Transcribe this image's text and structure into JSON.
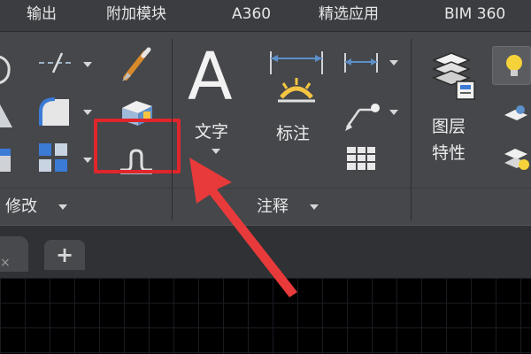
{
  "tabs": [
    {
      "label": "输出"
    },
    {
      "label": "附加模块"
    },
    {
      "label": "A360"
    },
    {
      "label": "精选应用"
    },
    {
      "label": "BIM 360"
    }
  ],
  "panels": {
    "modify": {
      "title": "修改"
    },
    "annotation": {
      "title": "注释",
      "text_button": "文字",
      "dimension_button": "标注"
    },
    "layers": {
      "layer_props_line1": "图层",
      "layer_props_line2": "特性"
    }
  },
  "icons": {
    "text_glyph": "A",
    "add_tab_glyph": "+",
    "close_glyph": "×"
  },
  "colors": {
    "highlight": "#e0262a",
    "arrow": "#e83a3a",
    "ribbon": "#45474b",
    "tabbar": "#3b3d41"
  }
}
